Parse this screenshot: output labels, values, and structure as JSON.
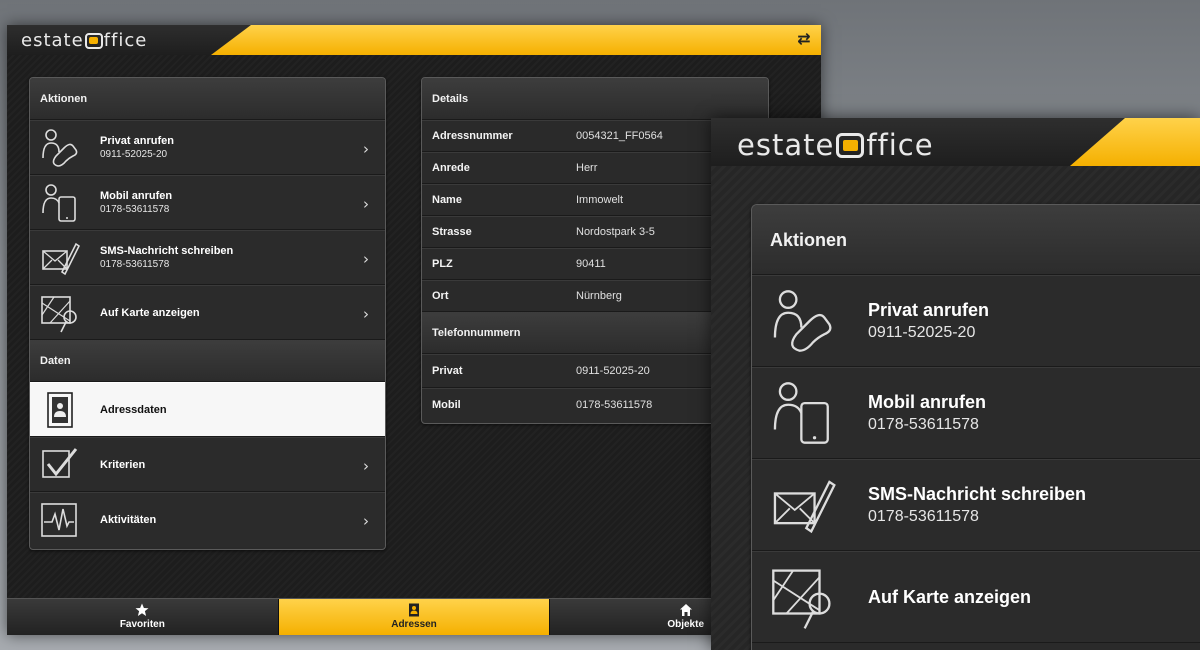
{
  "app": {
    "logo": {
      "before": "estate",
      "after": "ffice"
    },
    "actions_panel": {
      "title": "Aktionen",
      "items": [
        {
          "title": "Privat anrufen",
          "subtitle": "0911-52025-20"
        },
        {
          "title": "Mobil anrufen",
          "subtitle": "0178-53611578"
        },
        {
          "title": "SMS-Nachricht schreiben",
          "subtitle": "0178-53611578"
        },
        {
          "title": "Auf Karte anzeigen",
          "subtitle": ""
        }
      ],
      "data_section_title": "Daten",
      "data_items": [
        {
          "title": "Adressdaten",
          "selected": true
        },
        {
          "title": "Kriterien",
          "selected": false
        },
        {
          "title": "Aktivitäten",
          "selected": false
        }
      ]
    },
    "details_panel": {
      "title": "Details",
      "rows": [
        {
          "key": "Adressnummer",
          "value": "0054321_FF0564"
        },
        {
          "key": "Anrede",
          "value": "Herr"
        },
        {
          "key": "Name",
          "value": "Immowelt"
        },
        {
          "key": "Strasse",
          "value": "Nordostpark 3-5"
        },
        {
          "key": "PLZ",
          "value": "90411"
        },
        {
          "key": "Ort",
          "value": "Nürnberg"
        }
      ],
      "phones_title": "Telefonnummern",
      "phones": [
        {
          "key": "Privat",
          "value": "0911-52025-20"
        },
        {
          "key": "Mobil",
          "value": "0178-53611578"
        }
      ]
    },
    "bottom_nav": [
      {
        "label": "Favoriten",
        "icon": "star-icon",
        "active": false
      },
      {
        "label": "Adressen",
        "icon": "address-card-icon",
        "active": true
      },
      {
        "label": "Objekte",
        "icon": "home-icon",
        "active": false
      }
    ],
    "colors": {
      "accent": "#f5b000",
      "background": "#1d1d1d",
      "selected_row": "#f7f7f7"
    }
  },
  "zoom": {
    "logo": {
      "before": "estate",
      "after": "ffice"
    },
    "actions_panel": {
      "title": "Aktionen",
      "items": [
        {
          "title": "Privat anrufen",
          "subtitle": "0911-52025-20"
        },
        {
          "title": "Mobil anrufen",
          "subtitle": "0178-53611578"
        },
        {
          "title": "SMS-Nachricht schreiben",
          "subtitle": "0178-53611578"
        },
        {
          "title": "Auf Karte anzeigen",
          "subtitle": ""
        }
      ]
    }
  }
}
